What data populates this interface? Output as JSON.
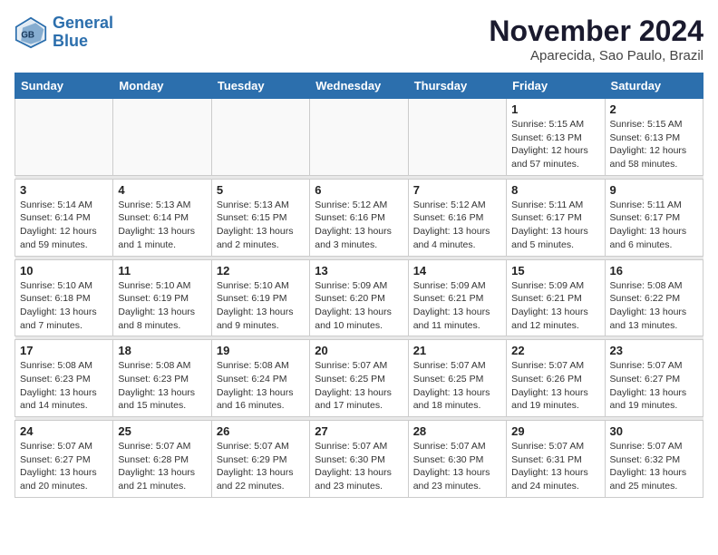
{
  "logo": {
    "line1": "General",
    "line2": "Blue"
  },
  "title": "November 2024",
  "subtitle": "Aparecida, Sao Paulo, Brazil",
  "days_of_week": [
    "Sunday",
    "Monday",
    "Tuesday",
    "Wednesday",
    "Thursday",
    "Friday",
    "Saturday"
  ],
  "weeks": [
    [
      {
        "day": "",
        "info": ""
      },
      {
        "day": "",
        "info": ""
      },
      {
        "day": "",
        "info": ""
      },
      {
        "day": "",
        "info": ""
      },
      {
        "day": "",
        "info": ""
      },
      {
        "day": "1",
        "info": "Sunrise: 5:15 AM\nSunset: 6:13 PM\nDaylight: 12 hours\nand 57 minutes."
      },
      {
        "day": "2",
        "info": "Sunrise: 5:15 AM\nSunset: 6:13 PM\nDaylight: 12 hours\nand 58 minutes."
      }
    ],
    [
      {
        "day": "3",
        "info": "Sunrise: 5:14 AM\nSunset: 6:14 PM\nDaylight: 12 hours\nand 59 minutes."
      },
      {
        "day": "4",
        "info": "Sunrise: 5:13 AM\nSunset: 6:14 PM\nDaylight: 13 hours\nand 1 minute."
      },
      {
        "day": "5",
        "info": "Sunrise: 5:13 AM\nSunset: 6:15 PM\nDaylight: 13 hours\nand 2 minutes."
      },
      {
        "day": "6",
        "info": "Sunrise: 5:12 AM\nSunset: 6:16 PM\nDaylight: 13 hours\nand 3 minutes."
      },
      {
        "day": "7",
        "info": "Sunrise: 5:12 AM\nSunset: 6:16 PM\nDaylight: 13 hours\nand 4 minutes."
      },
      {
        "day": "8",
        "info": "Sunrise: 5:11 AM\nSunset: 6:17 PM\nDaylight: 13 hours\nand 5 minutes."
      },
      {
        "day": "9",
        "info": "Sunrise: 5:11 AM\nSunset: 6:17 PM\nDaylight: 13 hours\nand 6 minutes."
      }
    ],
    [
      {
        "day": "10",
        "info": "Sunrise: 5:10 AM\nSunset: 6:18 PM\nDaylight: 13 hours\nand 7 minutes."
      },
      {
        "day": "11",
        "info": "Sunrise: 5:10 AM\nSunset: 6:19 PM\nDaylight: 13 hours\nand 8 minutes."
      },
      {
        "day": "12",
        "info": "Sunrise: 5:10 AM\nSunset: 6:19 PM\nDaylight: 13 hours\nand 9 minutes."
      },
      {
        "day": "13",
        "info": "Sunrise: 5:09 AM\nSunset: 6:20 PM\nDaylight: 13 hours\nand 10 minutes."
      },
      {
        "day": "14",
        "info": "Sunrise: 5:09 AM\nSunset: 6:21 PM\nDaylight: 13 hours\nand 11 minutes."
      },
      {
        "day": "15",
        "info": "Sunrise: 5:09 AM\nSunset: 6:21 PM\nDaylight: 13 hours\nand 12 minutes."
      },
      {
        "day": "16",
        "info": "Sunrise: 5:08 AM\nSunset: 6:22 PM\nDaylight: 13 hours\nand 13 minutes."
      }
    ],
    [
      {
        "day": "17",
        "info": "Sunrise: 5:08 AM\nSunset: 6:23 PM\nDaylight: 13 hours\nand 14 minutes."
      },
      {
        "day": "18",
        "info": "Sunrise: 5:08 AM\nSunset: 6:23 PM\nDaylight: 13 hours\nand 15 minutes."
      },
      {
        "day": "19",
        "info": "Sunrise: 5:08 AM\nSunset: 6:24 PM\nDaylight: 13 hours\nand 16 minutes."
      },
      {
        "day": "20",
        "info": "Sunrise: 5:07 AM\nSunset: 6:25 PM\nDaylight: 13 hours\nand 17 minutes."
      },
      {
        "day": "21",
        "info": "Sunrise: 5:07 AM\nSunset: 6:25 PM\nDaylight: 13 hours\nand 18 minutes."
      },
      {
        "day": "22",
        "info": "Sunrise: 5:07 AM\nSunset: 6:26 PM\nDaylight: 13 hours\nand 19 minutes."
      },
      {
        "day": "23",
        "info": "Sunrise: 5:07 AM\nSunset: 6:27 PM\nDaylight: 13 hours\nand 19 minutes."
      }
    ],
    [
      {
        "day": "24",
        "info": "Sunrise: 5:07 AM\nSunset: 6:27 PM\nDaylight: 13 hours\nand 20 minutes."
      },
      {
        "day": "25",
        "info": "Sunrise: 5:07 AM\nSunset: 6:28 PM\nDaylight: 13 hours\nand 21 minutes."
      },
      {
        "day": "26",
        "info": "Sunrise: 5:07 AM\nSunset: 6:29 PM\nDaylight: 13 hours\nand 22 minutes."
      },
      {
        "day": "27",
        "info": "Sunrise: 5:07 AM\nSunset: 6:30 PM\nDaylight: 13 hours\nand 23 minutes."
      },
      {
        "day": "28",
        "info": "Sunrise: 5:07 AM\nSunset: 6:30 PM\nDaylight: 13 hours\nand 23 minutes."
      },
      {
        "day": "29",
        "info": "Sunrise: 5:07 AM\nSunset: 6:31 PM\nDaylight: 13 hours\nand 24 minutes."
      },
      {
        "day": "30",
        "info": "Sunrise: 5:07 AM\nSunset: 6:32 PM\nDaylight: 13 hours\nand 25 minutes."
      }
    ]
  ]
}
